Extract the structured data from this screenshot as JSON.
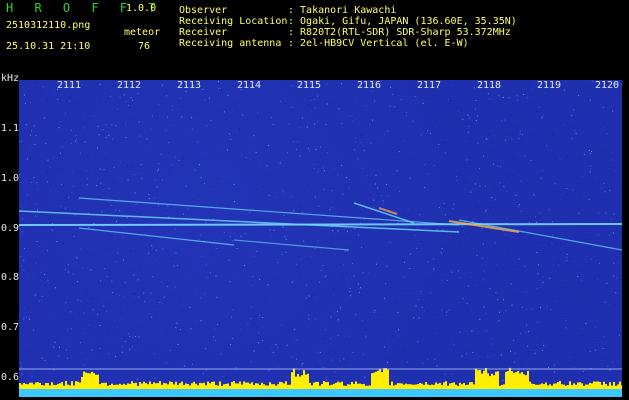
{
  "header": {
    "logo": "H R O F F T",
    "version": "1.0.0",
    "filename": "2510312110.png",
    "meteor_label": "meteor",
    "datetime": "25.10.31 21:10",
    "meteor_count": "76"
  },
  "info": [
    {
      "key": "Observer",
      "value": ": Takanori Kawachi"
    },
    {
      "key": "Receiving Location",
      "value": ": Ogaki, Gifu, JAPAN (136.60E, 35.35N)"
    },
    {
      "key": "Receiver",
      "value": ": R820T2(RTL-SDR) SDR-Sharp 53.372MHz"
    },
    {
      "key": "Receiving antenna",
      "value": ": 2el-HB9CV Vertical (el. E-W)"
    }
  ],
  "axis": {
    "y_unit": "kHz",
    "y_ticks": [
      "1.1",
      "1.0",
      "0.9",
      "0.8",
      "0.7",
      "0.6"
    ],
    "x_ticks": [
      "2111",
      "2112",
      "2113",
      "2114",
      "2115",
      "2116",
      "2117",
      "2118",
      "2119",
      "2120"
    ]
  },
  "colors": {
    "background": "#000000",
    "spectrogram": "#1c2ab0",
    "header_green": "#2bd42b",
    "header_yellow": "#ffff66",
    "carrier": "#7fe0ff",
    "activity": "#ffee00"
  }
}
